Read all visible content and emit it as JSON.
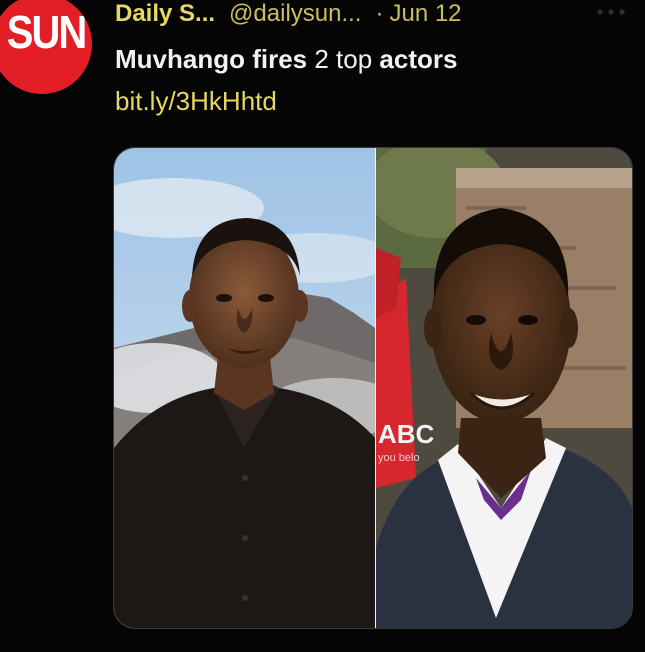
{
  "account": {
    "avatar_text": "SUN",
    "display_name": "Daily S...",
    "handle": "@dailysun...",
    "separator": "·",
    "date": "Jun 12",
    "avatar_color": "#e41e26"
  },
  "tweet": {
    "text_part1": "Muvhango fires",
    "text_part2": " 2 top ",
    "text_part3": "actors",
    "link": "bit.ly/3HkHhtd"
  },
  "media": {
    "left_image": "portrait-man-black-shirt-mountain-background",
    "right_image": "portrait-man-suit-smiling",
    "right_sign_text": "ABC",
    "right_sign_subtext": "you belo"
  },
  "icons": {
    "more": "more-options-icon"
  },
  "colors": {
    "accent": "#e6d860",
    "background": "#050505",
    "text": "#f2f2f2"
  }
}
